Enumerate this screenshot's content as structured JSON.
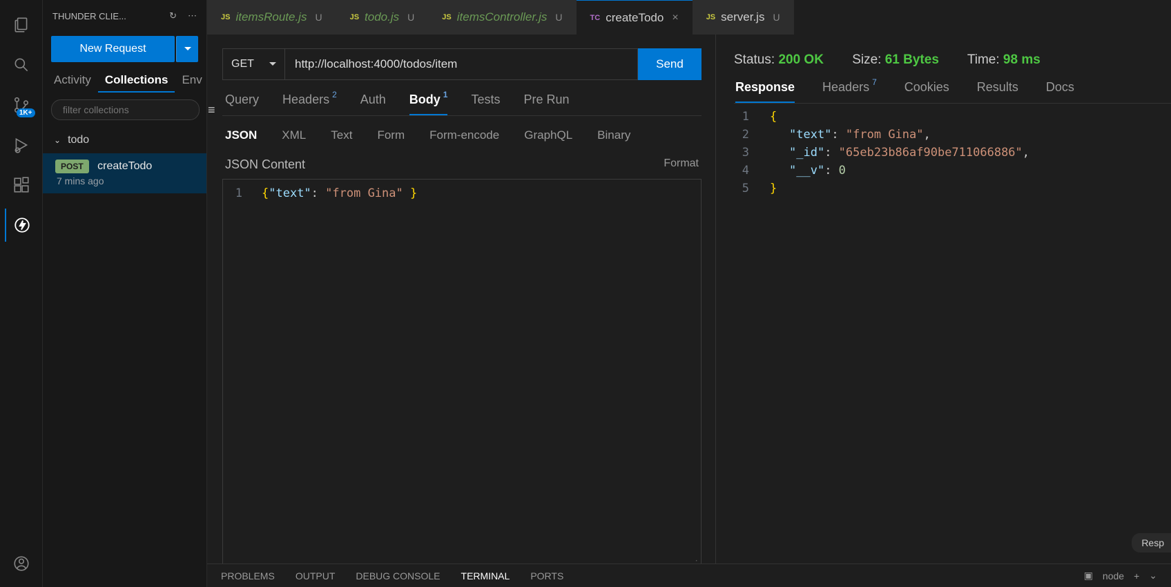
{
  "sidebar": {
    "title": "THUNDER CLIE...",
    "new_request": "New Request",
    "tabs": [
      "Activity",
      "Collections",
      "Env"
    ],
    "filter_placeholder": "filter collections",
    "collection": {
      "name": "todo",
      "request": {
        "method": "POST",
        "name": "createTodo",
        "time": "7 mins ago"
      }
    },
    "source_control_badge": "1K+"
  },
  "editor_tabs": [
    {
      "icon": "JS",
      "name": "itemsRoute.js",
      "status": "U"
    },
    {
      "icon": "JS",
      "name": "todo.js",
      "status": "U"
    },
    {
      "icon": "JS",
      "name": "itemsController.js",
      "status": "U"
    },
    {
      "icon": "TC",
      "name": "createTodo",
      "status": "×",
      "active": true
    },
    {
      "icon": "JS",
      "name": "server.js",
      "status": "U"
    }
  ],
  "request": {
    "method": "GET",
    "url": "http://localhost:4000/todos/item",
    "send": "Send",
    "tabs": {
      "query": "Query",
      "headers": "Headers",
      "headers_count": "2",
      "auth": "Auth",
      "body": "Body",
      "body_count": "1",
      "tests": "Tests",
      "prerun": "Pre Run"
    },
    "body_types": [
      "JSON",
      "XML",
      "Text",
      "Form",
      "Form-encode",
      "GraphQL",
      "Binary"
    ],
    "json_content_label": "JSON Content",
    "format": "Format",
    "json_body_raw": "{\"text\": \"from Gina\" }",
    "json_body": {
      "text": "from Gina"
    }
  },
  "response": {
    "status_label": "Status:",
    "status": "200 OK",
    "size_label": "Size:",
    "size": "61 Bytes",
    "time_label": "Time:",
    "time": "98 ms",
    "tabs": {
      "response": "Response",
      "headers": "Headers",
      "headers_count": "7",
      "cookies": "Cookies",
      "results": "Results",
      "docs": "Docs"
    },
    "lines": [
      "{",
      "\"text\": \"from Gina\",",
      "\"_id\": \"65eb23b86af90be711066886\",",
      "\"__v\": 0",
      "}"
    ],
    "body": {
      "text": "from Gina",
      "_id": "65eb23b86af90be711066886",
      "__v": 0
    }
  },
  "bottom_panel": {
    "problems": "PROBLEMS",
    "output": "OUTPUT",
    "debug": "DEBUG CONSOLE",
    "terminal": "TERMINAL",
    "ports": "PORTS",
    "node": "node",
    "plus": "+",
    "resp_pill": "Resp"
  }
}
